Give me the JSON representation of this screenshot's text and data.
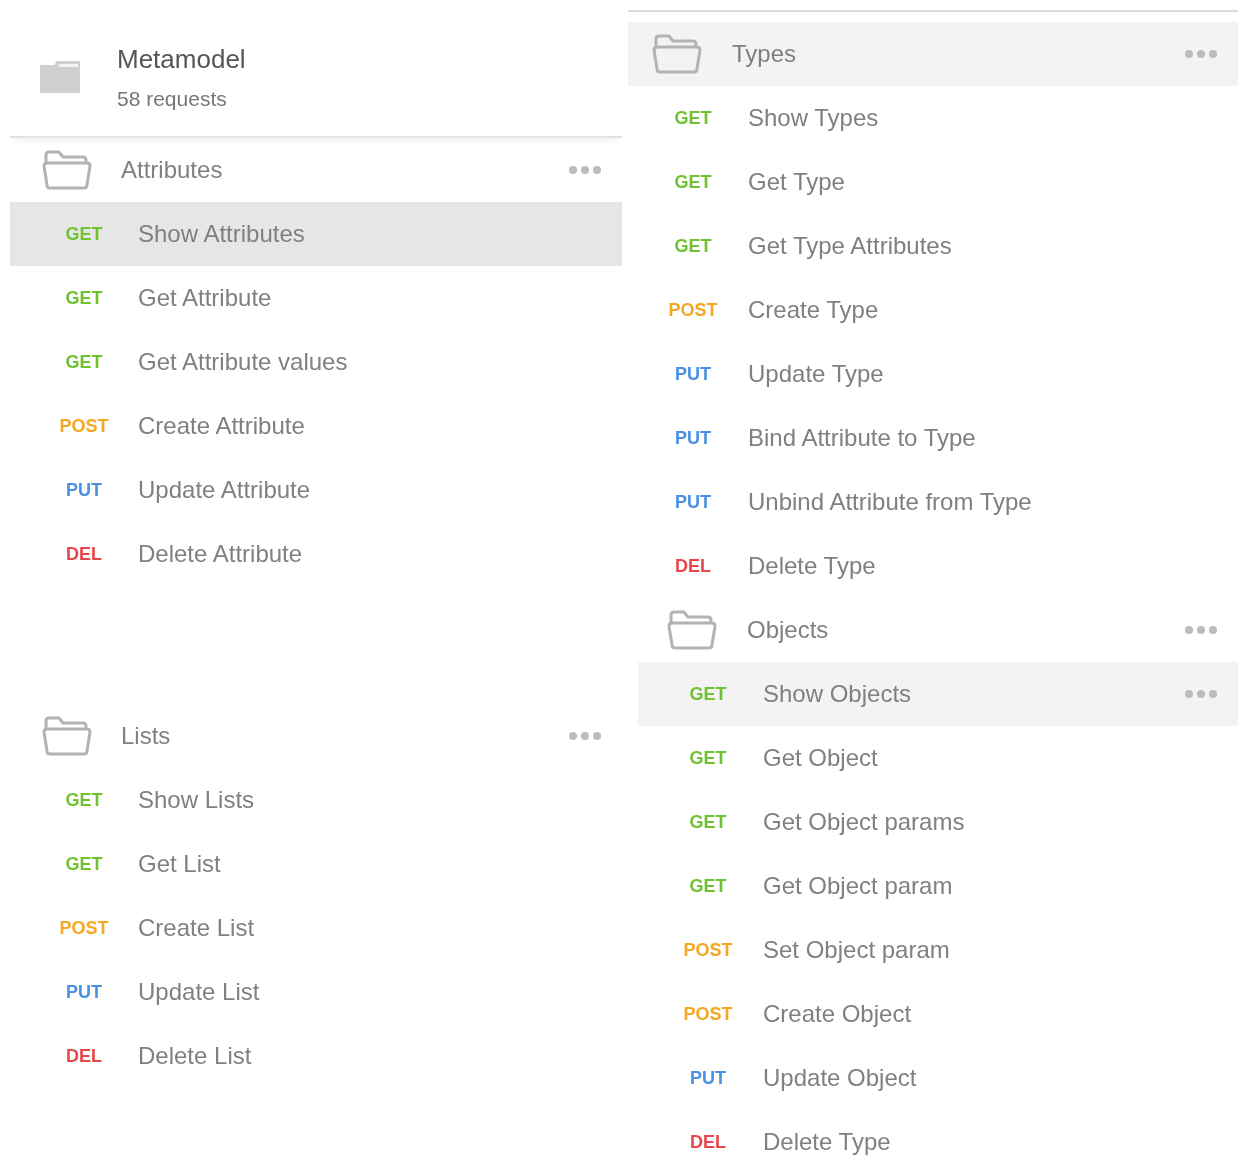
{
  "collection": {
    "name": "Metamodel",
    "count": "58 requests"
  },
  "left_panel": {
    "folders": [
      {
        "name": "Attributes",
        "hovered": false,
        "requests": [
          {
            "method": "GET",
            "kind": "get",
            "name": "Show Attributes",
            "selected": true,
            "hovered": false
          },
          {
            "method": "GET",
            "kind": "get",
            "name": "Get Attribute",
            "selected": false,
            "hovered": false
          },
          {
            "method": "GET",
            "kind": "get",
            "name": "Get Attribute values",
            "selected": false,
            "hovered": false
          },
          {
            "method": "POST",
            "kind": "post",
            "name": "Create Attribute",
            "selected": false,
            "hovered": false
          },
          {
            "method": "PUT",
            "kind": "put",
            "name": "Update Attribute",
            "selected": false,
            "hovered": false
          },
          {
            "method": "DEL",
            "kind": "del",
            "name": "Delete Attribute",
            "selected": false,
            "hovered": false
          }
        ]
      },
      {
        "name": "Lists",
        "hovered": false,
        "requests": [
          {
            "method": "GET",
            "kind": "get",
            "name": "Show Lists",
            "selected": false,
            "hovered": false
          },
          {
            "method": "GET",
            "kind": "get",
            "name": "Get List",
            "selected": false,
            "hovered": false
          },
          {
            "method": "POST",
            "kind": "post",
            "name": "Create List",
            "selected": false,
            "hovered": false
          },
          {
            "method": "PUT",
            "kind": "put",
            "name": "Update List",
            "selected": false,
            "hovered": false
          },
          {
            "method": "DEL",
            "kind": "del",
            "name": "Delete List",
            "selected": false,
            "hovered": false
          }
        ]
      }
    ]
  },
  "right_panel": {
    "folders": [
      {
        "name": "Types",
        "hovered": true,
        "requests": [
          {
            "method": "GET",
            "kind": "get",
            "name": "Show Types",
            "selected": false,
            "hovered": false
          },
          {
            "method": "GET",
            "kind": "get",
            "name": "Get Type",
            "selected": false,
            "hovered": false
          },
          {
            "method": "GET",
            "kind": "get",
            "name": "Get Type Attributes",
            "selected": false,
            "hovered": false
          },
          {
            "method": "POST",
            "kind": "post",
            "name": "Create Type",
            "selected": false,
            "hovered": false
          },
          {
            "method": "PUT",
            "kind": "put",
            "name": "Update Type",
            "selected": false,
            "hovered": false
          },
          {
            "method": "PUT",
            "kind": "put",
            "name": "Bind Attribute to Type",
            "selected": false,
            "hovered": false
          },
          {
            "method": "PUT",
            "kind": "put",
            "name": "Unbind Attribute from Type",
            "selected": false,
            "hovered": false
          },
          {
            "method": "DEL",
            "kind": "del",
            "name": "Delete Type",
            "selected": false,
            "hovered": false
          }
        ],
        "children": [
          {
            "name": "Objects",
            "hovered": false,
            "requests": [
              {
                "method": "GET",
                "kind": "get",
                "name": "Show Objects",
                "selected": false,
                "hovered": true
              },
              {
                "method": "GET",
                "kind": "get",
                "name": "Get Object",
                "selected": false,
                "hovered": false
              },
              {
                "method": "GET",
                "kind": "get",
                "name": "Get Object params",
                "selected": false,
                "hovered": false
              },
              {
                "method": "GET",
                "kind": "get",
                "name": "Get Object param",
                "selected": false,
                "hovered": false
              },
              {
                "method": "POST",
                "kind": "post",
                "name": "Set Object param",
                "selected": false,
                "hovered": false
              },
              {
                "method": "POST",
                "kind": "post",
                "name": "Create Object",
                "selected": false,
                "hovered": false
              },
              {
                "method": "PUT",
                "kind": "put",
                "name": "Update Object",
                "selected": false,
                "hovered": false
              },
              {
                "method": "DEL",
                "kind": "del",
                "name": "Delete Type",
                "selected": false,
                "hovered": false
              }
            ]
          }
        ]
      }
    ]
  }
}
